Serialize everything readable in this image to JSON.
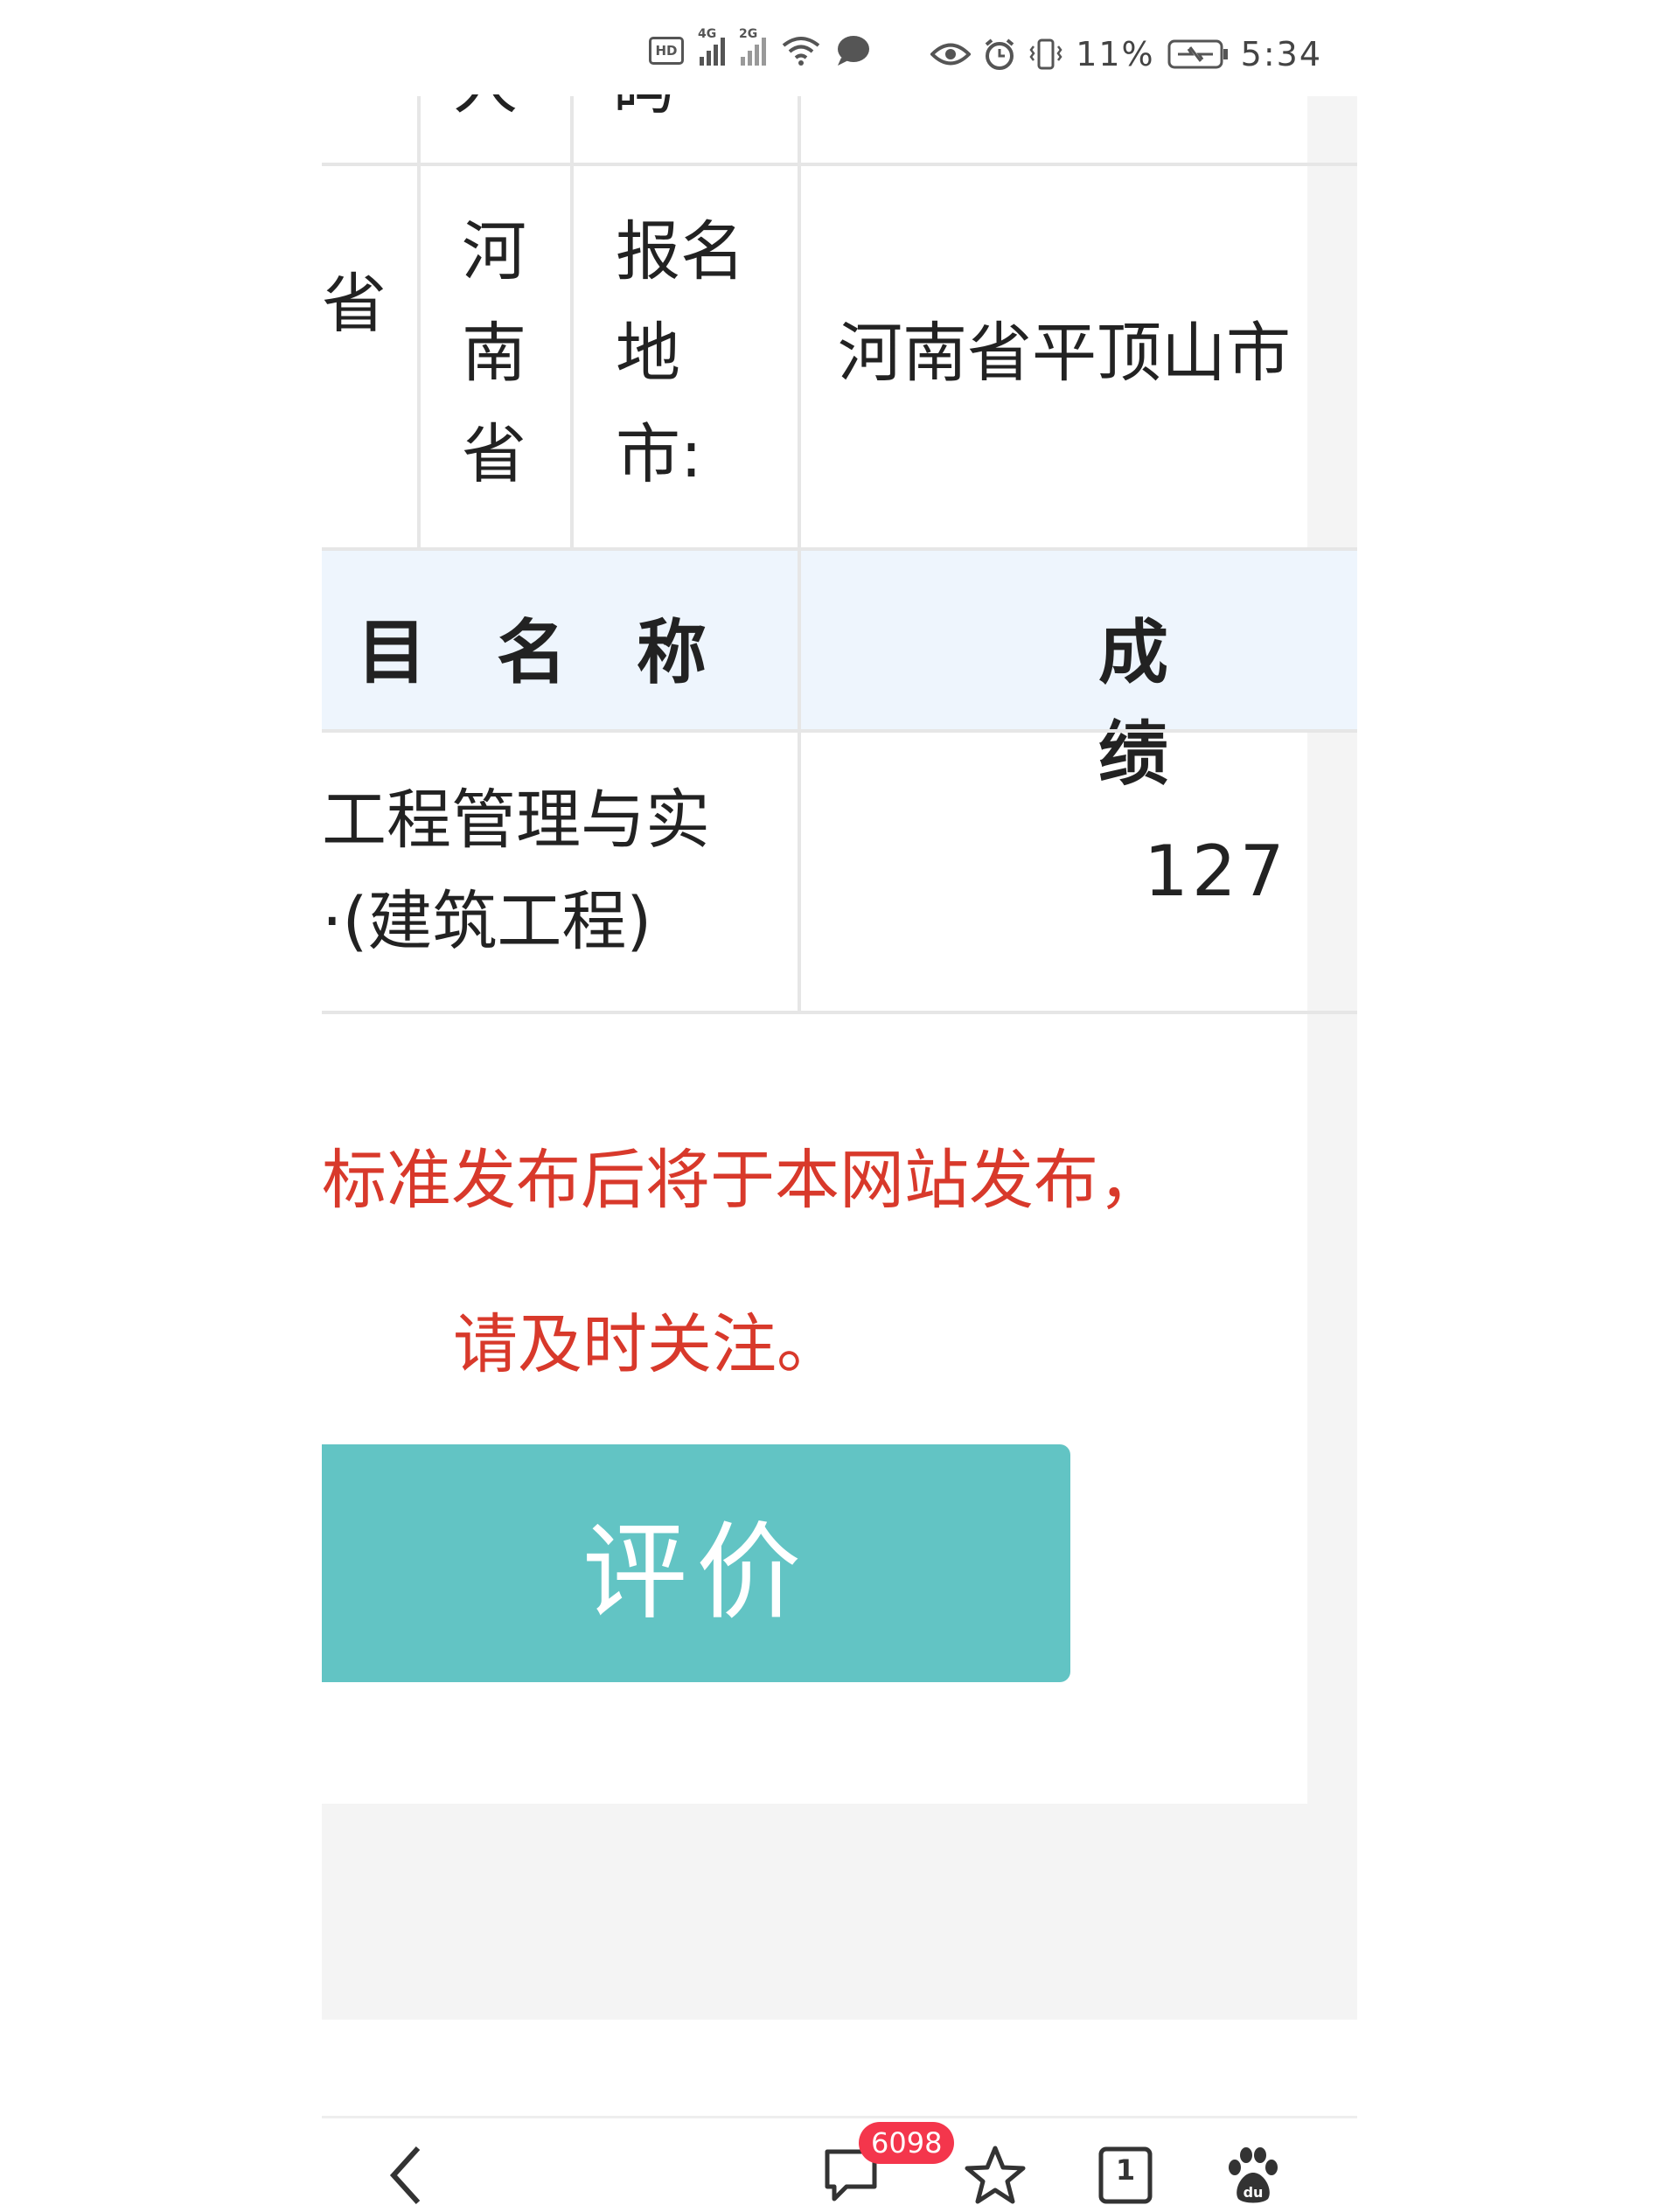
{
  "status_bar": {
    "hd_label": "HD",
    "signal1_label": "4G",
    "signal2_label": "2G",
    "battery_percent": "11%",
    "time": "5:34"
  },
  "info_table": {
    "partial_top_chars": [
      "人",
      "码"
    ],
    "province_label_partial": "省",
    "province_value": [
      "河",
      "南",
      "省"
    ],
    "registration_label": [
      "报名",
      "地",
      "市:"
    ],
    "registration_value": "河南省平顶山市"
  },
  "score_table": {
    "header_subject": "目名称",
    "header_score": "成绩",
    "rows": [
      {
        "subject_line1": "工程管理与实",
        "subject_line2": "·(建筑工程)",
        "score": "127"
      }
    ]
  },
  "notice": {
    "line1": "标准发布后将于本网站发布，",
    "line2": "请及时关注。",
    "color": "#d8392b"
  },
  "evaluate_button": {
    "label": "评价",
    "color": "#62c4c4"
  },
  "bottom_nav": {
    "comments_count": "6098",
    "tabs_count": "1"
  }
}
